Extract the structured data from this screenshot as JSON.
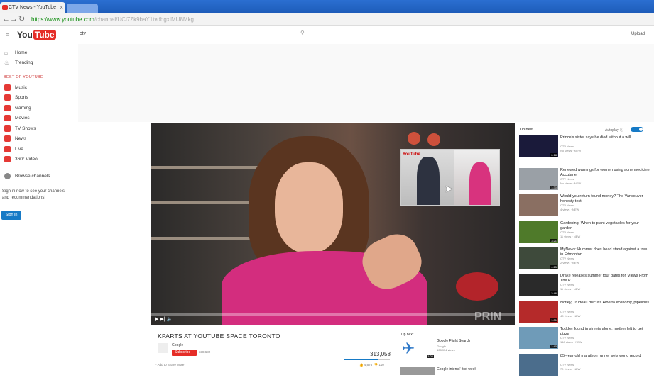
{
  "browser": {
    "tab_title": "CTV News - YouTube",
    "tab_close": "×",
    "url_host": "https://www.youtube.com",
    "url_path": "/channel/UCi7Zk9baY1tvdbgxIMU8Mkg"
  },
  "header": {
    "logo_you": "You",
    "logo_tube": "Tube",
    "search_value": "ctv",
    "upload_label": "Upload"
  },
  "sidebar": {
    "home": "Home",
    "trending": "Trending",
    "section_title": "BEST OF YOUTUBE",
    "items": [
      {
        "label": "Music",
        "color": "#e53935"
      },
      {
        "label": "Sports",
        "color": "#e53935"
      },
      {
        "label": "Gaming",
        "color": "#e53935"
      },
      {
        "label": "Movies",
        "color": "#e53935"
      },
      {
        "label": "TV Shows",
        "color": "#e53935"
      },
      {
        "label": "News",
        "color": "#e53935"
      },
      {
        "label": "Live",
        "color": "#e53935"
      },
      {
        "label": "360° Video",
        "color": "#e53935"
      }
    ],
    "browse": "Browse channels",
    "signin_text": "Sign in now to see your channels and recommendations!",
    "signin_button": "Sign in"
  },
  "player": {
    "progress_fraction": 0.0,
    "pip_logo": "YouTube",
    "controls": "▶ ▶| 🔈",
    "watermark": "PRIN"
  },
  "video": {
    "title": "KPARTS AT YOUTUBE SPACE TORONTO",
    "channel": "Google",
    "subscribe": "Subscribe",
    "sub_count": "338,682",
    "views": "313,058",
    "like_fraction": 0.75,
    "likes": "4,676",
    "dislikes": "110",
    "actions": "Add to    Share    More"
  },
  "mid_upnext": {
    "label": "Up next",
    "item1_title": "Google Flight Search",
    "item1_channel": "Google",
    "item1_views": "608,934 views",
    "item1_duration": "1:06",
    "item2_title": "Google interns' first week"
  },
  "right": {
    "up_next": "Up next",
    "autoplay": "Autoplay",
    "items": [
      {
        "title": "Prince's sister says he died without a will",
        "channel": "CTV News",
        "views": "No views · NEW",
        "duration": "0:18",
        "thumb": "#1a1a3a"
      },
      {
        "title": "Renewed warnings for women using acne medicine Accutane",
        "channel": "CTV News",
        "views": "No views · NEW",
        "duration": "1:30",
        "thumb": "#9aa0a6"
      },
      {
        "title": "Would you return found money? The Vancouver honesty test",
        "channel": "CTV News",
        "views": "4 views · NEW",
        "duration": "",
        "thumb": "#8a6f62"
      },
      {
        "title": "Gardening: When to plant vegetables for your garden",
        "channel": "CTV News",
        "views": "11 views · NEW",
        "duration": "3:21",
        "thumb": "#4f7a2a"
      },
      {
        "title": "MyNews: Hummer does head stand against a tree in Edmonton",
        "channel": "CTV News",
        "views": "2 views · NEW",
        "duration": "4:25",
        "thumb": "#3e4a3b"
      },
      {
        "title": "Drake releases summer tour dates for 'Views From The 6'",
        "channel": "CTV News",
        "views": "11 views · NEW",
        "duration": "2:46",
        "thumb": "#2a2a2a"
      },
      {
        "title": "Notley, Trudeau discuss Alberta economy, pipelines",
        "channel": "CTV News",
        "views": "48 views · NEW",
        "duration": "1:01",
        "thumb": "#b52a2a"
      },
      {
        "title": "Toddler found in streets alone, mother left to get pizza",
        "channel": "CTV News",
        "views": "148 views · NEW",
        "duration": "1:40",
        "thumb": "#6f9bb8"
      },
      {
        "title": "85-year-old marathon runner sets world record",
        "channel": "CTV News",
        "views": "70 views · NEW",
        "duration": "",
        "thumb": "#4b6d8c"
      }
    ]
  }
}
